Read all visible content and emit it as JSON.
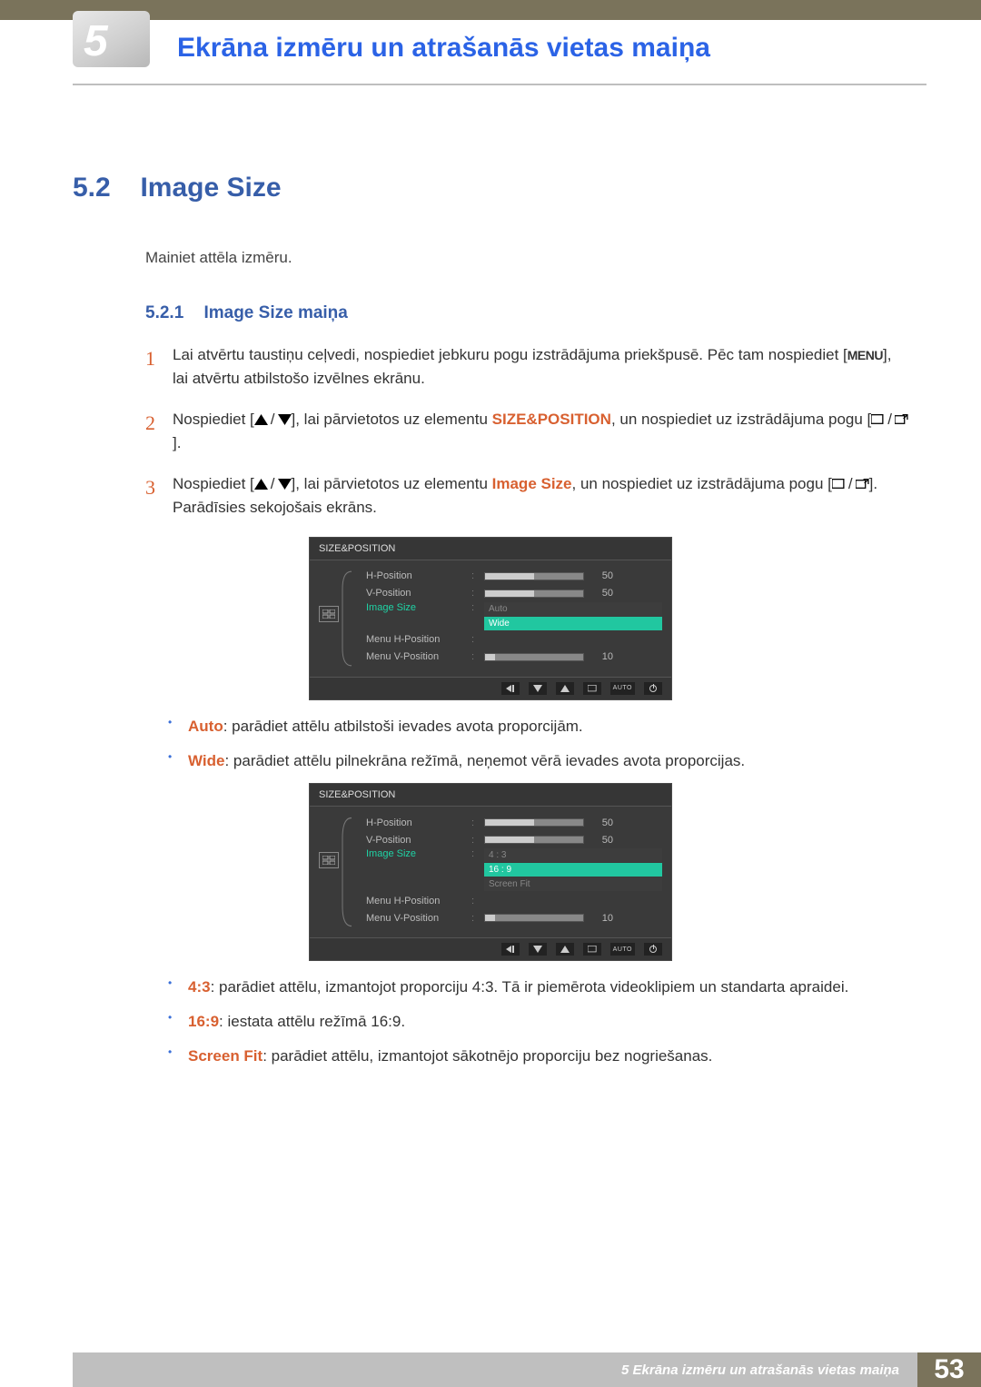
{
  "header": {
    "chapter_number": "5",
    "page_title": "Ekrāna izmēru un atrašanās vietas maiņa"
  },
  "section": {
    "number": "5.2",
    "title": "Image Size",
    "intro": "Mainiet attēla izmēru."
  },
  "subsection": {
    "number": "5.2.1",
    "title": "Image Size maiņa"
  },
  "steps": {
    "s1": {
      "num": "1",
      "pre": "Lai atvērtu taustiņu ceļvedi, nospiediet jebkuru pogu izstrādājuma priekšpusē. Pēc tam nospiediet [",
      "menu": "MENU",
      "post": "], lai atvērtu atbilstošo izvēlnes ekrānu."
    },
    "s2": {
      "num": "2",
      "pre": "Nospiediet [",
      "mid": "], lai pārvietotos uz elementu ",
      "kw": "SIZE&POSITION",
      "post1": ", un nospiediet uz izstrādājuma pogu [",
      "post2": "]."
    },
    "s3": {
      "num": "3",
      "pre": "Nospiediet [",
      "mid": "], lai pārvietotos uz elementu ",
      "kw": "Image Size",
      "post1": ", un nospiediet uz izstrādājuma pogu [",
      "post2": "]. Parādīsies sekojošais ekrāns."
    }
  },
  "osd": {
    "title": "SIZE&POSITION",
    "rows": {
      "hpos": "H-Position",
      "vpos": "V-Position",
      "isize": "Image Size",
      "mhpos": "Menu H-Position",
      "mvpos": "Menu V-Position"
    },
    "vals": {
      "fifty": "50",
      "ten": "10"
    },
    "opts1": {
      "a": "Auto",
      "b": "Wide"
    },
    "opts2": {
      "a": "4 : 3",
      "b": "16 : 9",
      "c": "Screen Fit"
    },
    "auto": "AUTO"
  },
  "bullets1": {
    "auto_k": "Auto",
    "auto_t": ": parādiet attēlu atbilstoši ievades avota proporcijām.",
    "wide_k": "Wide",
    "wide_t": ": parādiet attēlu pilnekrāna režīmā, neņemot vērā ievades avota proporcijas."
  },
  "bullets2": {
    "r43_k": "4:3",
    "r43_t": ": parādiet attēlu, izmantojot proporciju 4:3. Tā ir piemērota videoklipiem un standarta apraidei.",
    "r169_k": "16:9",
    "r169_t": ": iestata attēlu režīmā 16:9.",
    "sf_k": "Screen Fit",
    "sf_t": ": parādiet attēlu, izmantojot sākotnējo proporciju bez nogriešanas."
  },
  "footer": {
    "text": "5 Ekrāna izmēru un atrašanās vietas maiņa",
    "page": "53"
  }
}
